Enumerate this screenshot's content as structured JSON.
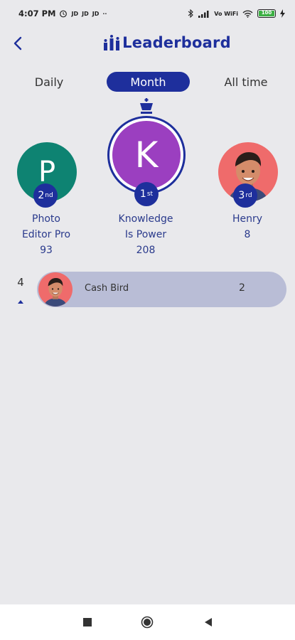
{
  "status_bar": {
    "time": "4:07 PM",
    "indicators": [
      "JD",
      "JD",
      "JD"
    ],
    "more": "··",
    "network": "Vo WiFi",
    "battery": "100"
  },
  "header": {
    "title": "Leaderboard"
  },
  "tabs": [
    {
      "label": "Daily",
      "active": false
    },
    {
      "label": "Month",
      "active": true
    },
    {
      "label": "All time",
      "active": false
    }
  ],
  "podium": {
    "first": {
      "initial": "K",
      "rank": "1",
      "suffix": "st",
      "name_line1": "Knowledge",
      "name_line2": "Is Power",
      "score": "208",
      "color": "#9b3fc0"
    },
    "second": {
      "initial": "P",
      "rank": "2",
      "suffix": "nd",
      "name_line1": "Photo",
      "name_line2": "Editor Pro",
      "score": "93",
      "color": "#0e8372"
    },
    "third": {
      "rank": "3",
      "suffix": "rd",
      "name_line1": "Henry",
      "name_line2": "8",
      "color": "#ef6b6b"
    }
  },
  "list": [
    {
      "position": "4",
      "name": "Cash Bird",
      "score": "2"
    }
  ],
  "colors": {
    "accent": "#1e2f9c",
    "background": "#e9e9ec",
    "row": "#b9bdd6"
  }
}
